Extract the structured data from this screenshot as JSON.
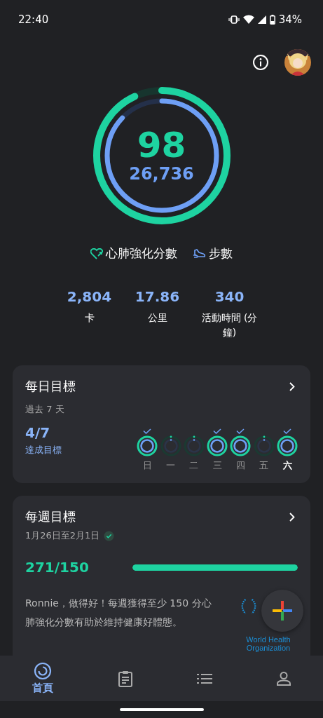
{
  "status_bar": {
    "time": "22:40",
    "battery": "34%"
  },
  "rings": {
    "score": "98",
    "steps": "26,736"
  },
  "legend": [
    {
      "kind": "heart",
      "label": "心肺強化分數"
    },
    {
      "kind": "steps",
      "label": "步數"
    }
  ],
  "stats": [
    {
      "value": "2,804",
      "label": "卡"
    },
    {
      "value": "17.86",
      "label": "公里"
    },
    {
      "value": "340",
      "label": "活動時間 (分鐘)"
    }
  ],
  "daily_goal": {
    "title": "每日目標",
    "subtitle": "過去 7 天",
    "count": "4/7",
    "count_label": "達成目標",
    "days": [
      {
        "label": "日",
        "done": true,
        "today": false
      },
      {
        "label": "一",
        "done": false,
        "today": false
      },
      {
        "label": "二",
        "done": false,
        "today": false
      },
      {
        "label": "三",
        "done": true,
        "today": false
      },
      {
        "label": "四",
        "done": true,
        "today": false
      },
      {
        "label": "五",
        "done": false,
        "today": false
      },
      {
        "label": "六",
        "done": true,
        "today": true
      }
    ]
  },
  "weekly_goal": {
    "title": "每週目標",
    "dates": "1月26日至2月1日",
    "achieved": true,
    "count": "271/150",
    "level": 1,
    "message": "Ronnie，做得好！每週獲得至少 150 分心肺強化分數有助於維持健康好體態。",
    "logo_text": "World Health Organization"
  },
  "nav": [
    {
      "kind": "home",
      "label": "首頁",
      "selected": true
    },
    {
      "kind": "journal",
      "selected": false
    },
    {
      "kind": "list",
      "selected": false
    },
    {
      "kind": "profile",
      "selected": false
    }
  ]
}
